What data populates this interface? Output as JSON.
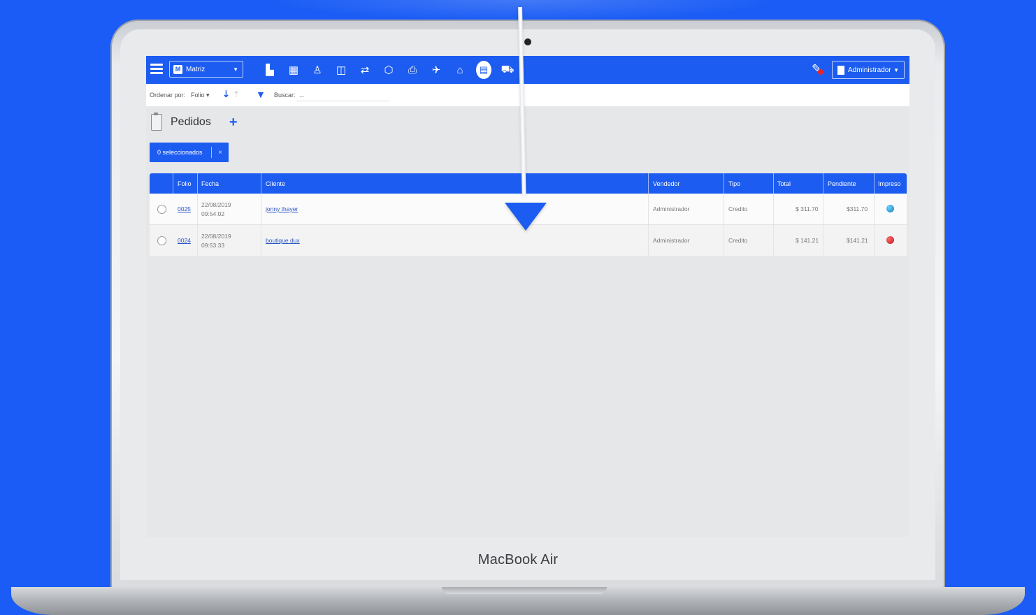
{
  "device": {
    "brand_label": "MacBook Air"
  },
  "topbar": {
    "branch_label": "Matriz",
    "branch_logo": "M",
    "nav_icons": [
      "chart-icon",
      "grid-icon",
      "user-icon",
      "tags-icon",
      "transfer-icon",
      "box-icon",
      "printer-icon",
      "truck-icon",
      "basket-icon",
      "clipboard-icon",
      "cart-icon"
    ],
    "user_label": "Administrador",
    "notification_icon": "megaphone-icon"
  },
  "toolbar": {
    "order_by_label": "Ordenar por:",
    "order_by_value": "Folio",
    "search_label": "Buscar:",
    "search_placeholder": "..."
  },
  "page": {
    "title": "Pedidos",
    "add_label": "+",
    "selected_label": "0 seleccionados",
    "clear_label": "×"
  },
  "table": {
    "columns": [
      "Folio",
      "Fecha",
      "Cliente",
      "Vendedor",
      "Tipo",
      "Total",
      "Pendiente",
      "Impreso"
    ],
    "rows": [
      {
        "folio": "0025",
        "date": "22/08/2019",
        "time": "09:54:02",
        "cliente": "jonny thayer",
        "vendedor": "Administrador",
        "tipo": "Credito",
        "total": "$ 311.70",
        "pendiente": "$311.70",
        "impreso_color": "#1a8fd0"
      },
      {
        "folio": "0024",
        "date": "22/08/2019",
        "time": "09:53:33",
        "cliente": "boutique dux",
        "vendedor": "Administrador",
        "tipo": "Credito",
        "total": "$ 141.21",
        "pendiente": "$141.21",
        "impreso_color": "#d0161c"
      }
    ]
  },
  "colors": {
    "accent": "#1c5cf0",
    "background": "#1a5cf5"
  }
}
